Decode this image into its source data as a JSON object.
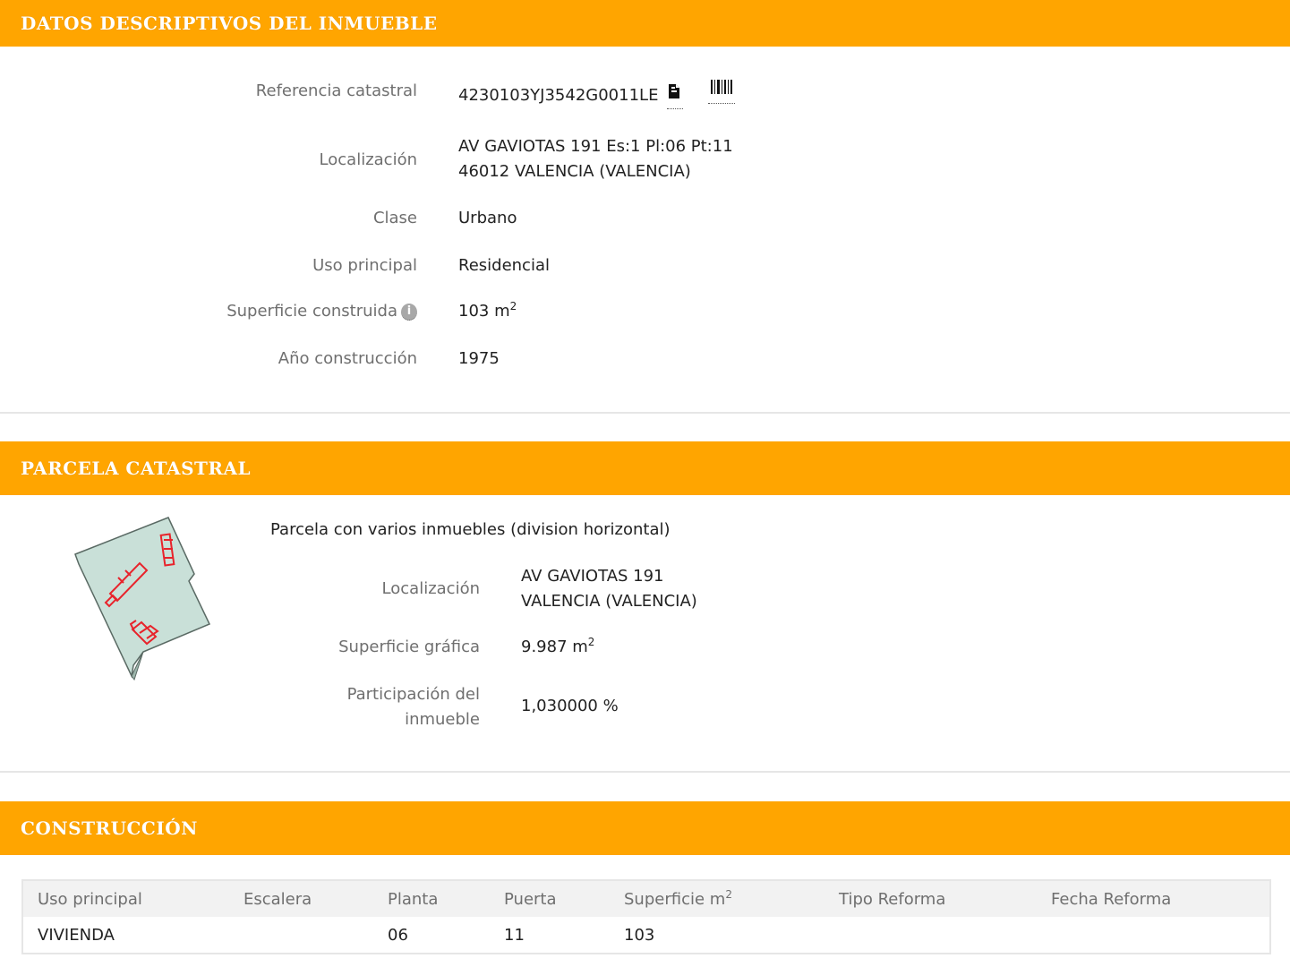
{
  "sections": {
    "datos": {
      "title": "DATOS DESCRIPTIVOS DEL INMUEBLE",
      "ref_label": "Referencia catastral",
      "ref_value": "4230103YJ3542G0011LE",
      "loc_label": "Localización",
      "loc_line1": "AV GAVIOTAS 191 Es:1 Pl:06 Pt:11",
      "loc_line2": "46012 VALENCIA (VALENCIA)",
      "clase_label": "Clase",
      "clase_value": "Urbano",
      "uso_label": "Uso principal",
      "uso_value": "Residencial",
      "sup_label": "Superficie construida",
      "sup_value": "103 m",
      "sup_exp": "2",
      "anio_label": "Año construcción",
      "anio_value": "1975"
    },
    "parcela": {
      "title": "PARCELA CATASTRAL",
      "description": "Parcela con varios inmuebles (division horizontal)",
      "loc_label": "Localización",
      "loc_line1": "AV GAVIOTAS 191",
      "loc_line2": "VALENCIA (VALENCIA)",
      "sup_label": "Superficie gráfica",
      "sup_value": "9.987 m",
      "sup_exp": "2",
      "part_label_1": "Participación del",
      "part_label_2": "inmueble",
      "part_value": "1,030000 %"
    },
    "construccion": {
      "title": "CONSTRUCCIÓN",
      "headers": {
        "uso": "Uso principal",
        "escalera": "Escalera",
        "planta": "Planta",
        "puerta": "Puerta",
        "superficie": "Superficie m",
        "superficie_exp": "2",
        "tipo_reforma": "Tipo Reforma",
        "fecha_reforma": "Fecha Reforma"
      },
      "row": {
        "uso": "VIVIENDA",
        "escalera": "",
        "planta": "06",
        "puerta": "11",
        "superficie": "103",
        "tipo_reforma": "",
        "fecha_reforma": ""
      }
    }
  },
  "colors": {
    "header_bg": "#ffa500",
    "parcel_fill": "#c9e0d8",
    "building_outline": "#e8232b"
  },
  "icons": {
    "copy": "copy-icon",
    "barcode": "barcode-icon",
    "info": "info-icon"
  }
}
